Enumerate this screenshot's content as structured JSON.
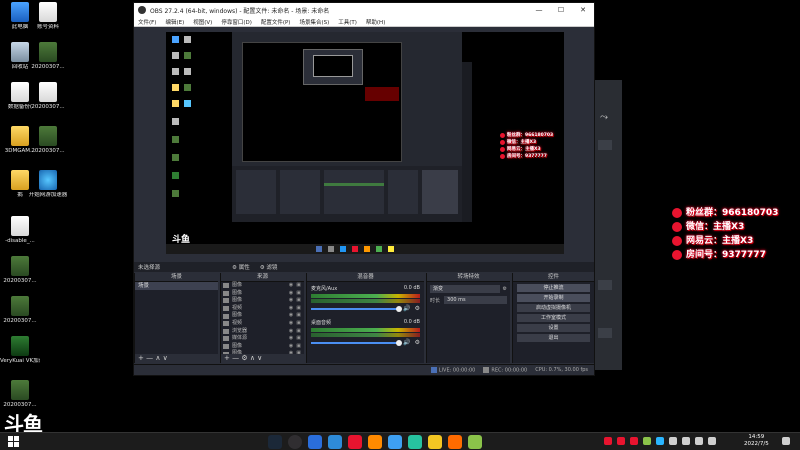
{
  "desktop": {
    "icons": [
      {
        "label": "此电脑",
        "kind": "pc"
      },
      {
        "label": "账号资料",
        "kind": "doc"
      },
      {
        "label": "回收站",
        "kind": "bin"
      },
      {
        "label": "20200307...",
        "kind": "img"
      },
      {
        "label": "数据备份(",
        "kind": "doc"
      },
      {
        "label": "20200307...",
        "kind": "doc"
      },
      {
        "label": "3DMGAM...",
        "kind": "folder"
      },
      {
        "label": "20200307...",
        "kind": "img"
      },
      {
        "label": "鹅",
        "kind": "folder"
      },
      {
        "label": "开始网游加速器",
        "kind": "globe"
      },
      {
        "label": "-disable_...",
        "kind": "doc"
      },
      {
        "label": "20200307...",
        "kind": "img"
      },
      {
        "label": "20200307...",
        "kind": "img"
      },
      {
        "label": "VeryKuai VK加速器",
        "kind": "app"
      },
      {
        "label": "20200307...",
        "kind": "img"
      }
    ],
    "logo_text": "斗鱼"
  },
  "overlay_stats": [
    {
      "text": "粉丝群：966180703"
    },
    {
      "text": "微信：主播X3"
    },
    {
      "text": "网易云：主播X3"
    },
    {
      "text": "房间号：9377777"
    }
  ],
  "obs": {
    "title": "OBS 27.2.4 (64-bit, windows) - 配置文件: 未命名 - 场景: 未命名",
    "window_controls": [
      "—",
      "☐",
      "✕"
    ],
    "menu": [
      "文件(F)",
      "编辑(E)",
      "视图(V)",
      "停靠窗口(D)",
      "配置文件(P)",
      "场景集合(S)",
      "工具(T)",
      "帮助(H)"
    ],
    "scene_bar": {
      "label": "未选择源",
      "tabs": [
        "属性",
        "滤镜"
      ]
    },
    "docks": {
      "scenes": {
        "title": "场景",
        "items": [
          "场景"
        ],
        "footer": "+ — ∧ ∨"
      },
      "sources": {
        "title": "来源",
        "items": [
          "图像",
          "图像",
          "图像",
          "视频",
          "图像",
          "视频",
          "浏览器",
          "媒体源",
          "图像",
          "图像"
        ],
        "footer": "+ — ⚙ ∧ ∨"
      },
      "mixer": {
        "title": "混音器",
        "channels": [
          {
            "name": "麦克风/Aux",
            "db": "0.0 dB"
          },
          {
            "name": "桌面音频",
            "db": "0.0 dB"
          }
        ]
      },
      "transitions": {
        "title": "转场特效",
        "type": "渐变",
        "duration_label": "时长",
        "duration": "300 ms"
      },
      "controls": {
        "title": "控件",
        "buttons": [
          "停止推流",
          "开始录制",
          "启动虚拟摄像机",
          "工作室模式",
          "设置",
          "退出"
        ]
      }
    },
    "status": {
      "live": "LIVE: 00:00:00",
      "rec": "REC: 00:00:00",
      "cpu": "CPU: 0.7%, 30.00 fps"
    }
  },
  "taskbar": {
    "apps": [
      "steam",
      "obs",
      "browser",
      "edge",
      "douyu",
      "search",
      "settings",
      "app-a",
      "app-b",
      "app-c",
      "app-d"
    ],
    "clock_time": "14:59",
    "clock_date": "2022/7/5"
  }
}
